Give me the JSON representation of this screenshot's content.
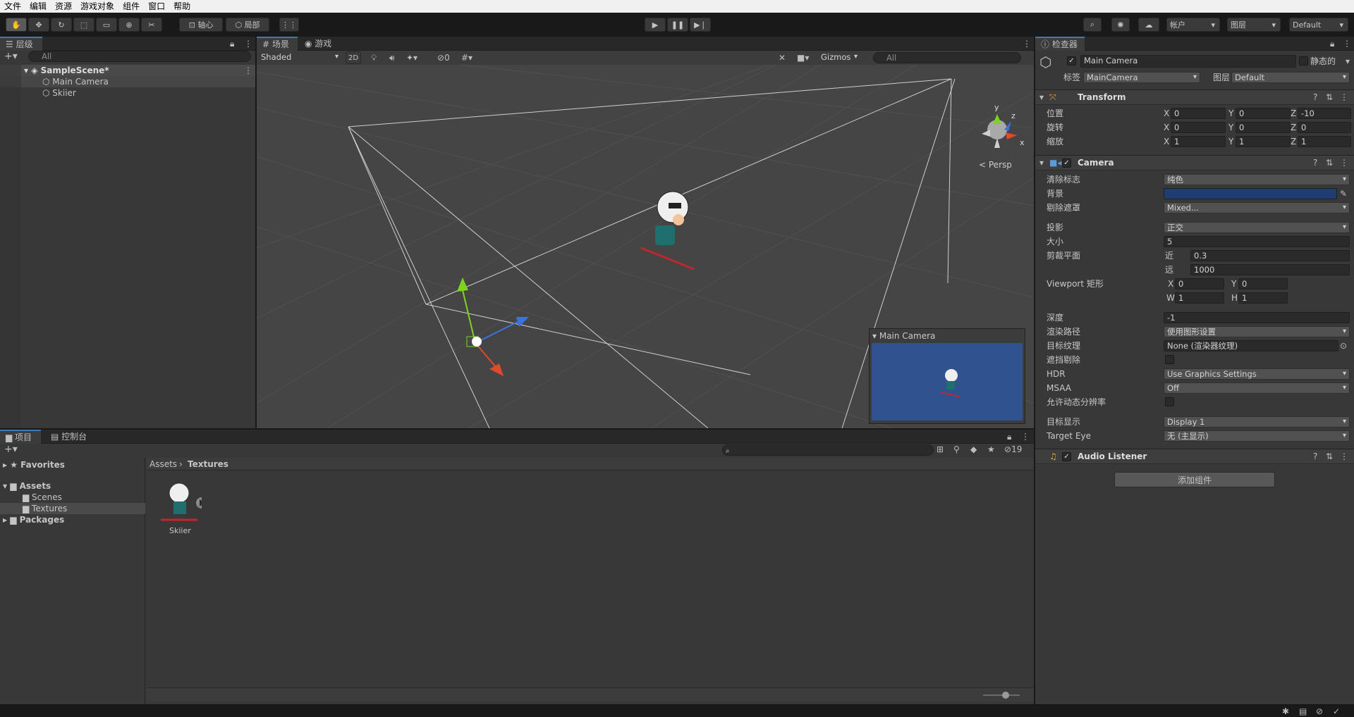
{
  "menu": [
    "文件",
    "编辑",
    "资源",
    "游戏对象",
    "组件",
    "窗口",
    "帮助"
  ],
  "toolbar": {
    "pivot": "轴心",
    "local": "局部",
    "account": "帐户",
    "layers": "图层",
    "layout": "Default"
  },
  "hierarchy": {
    "tab": "层级",
    "search_placeholder": "All",
    "scene": "SampleScene*",
    "items": [
      "Main Camera",
      "Skiier"
    ]
  },
  "scene_view": {
    "tab_scene": "场景",
    "tab_game": "游戏",
    "shading": "Shaded",
    "mode_2d": "2D",
    "hidden_count": "0",
    "gizmos": "Gizmos",
    "search_placeholder": "All",
    "persp": "Persp",
    "gizmo_y": "y",
    "gizmo_z": "z",
    "gizmo_x": "x",
    "cam_preview_title": "Main Camera"
  },
  "project": {
    "tab_project": "项目",
    "tab_console": "控制台",
    "favorites": "Favorites",
    "assets": "Assets",
    "scenes": "Scenes",
    "textures": "Textures",
    "packages": "Packages",
    "breadcrumb": [
      "Assets",
      "Textures"
    ],
    "asset_name": "Skiier",
    "count": "19"
  },
  "inspector": {
    "tab": "检查器",
    "object_name": "Main Camera",
    "static": "静态的",
    "tag_label": "标签",
    "tag_value": "MainCamera",
    "layer_label": "图层",
    "layer_value": "Default",
    "transform": {
      "title": "Transform",
      "position": "位置",
      "rotation": "旋转",
      "scale": "缩放",
      "pos": [
        "0",
        "0",
        "-10"
      ],
      "rot": [
        "0",
        "0",
        "0"
      ],
      "scl": [
        "1",
        "1",
        "1"
      ]
    },
    "camera": {
      "title": "Camera",
      "clear_flags": {
        "label": "清除标志",
        "value": "纯色"
      },
      "background": {
        "label": "背景",
        "color": "#1f3c75"
      },
      "culling": {
        "label": "剔除遮罩",
        "value": "Mixed..."
      },
      "projection": {
        "label": "投影",
        "value": "正交"
      },
      "size": {
        "label": "大小",
        "value": "5"
      },
      "clip": {
        "label": "剪裁平面",
        "near_label": "近",
        "near": "0.3",
        "far_label": "远",
        "far": "1000"
      },
      "viewport": {
        "label": "Viewport 矩形",
        "x": "0",
        "y": "0",
        "w": "1",
        "h": "1"
      },
      "depth": {
        "label": "深度",
        "value": "-1"
      },
      "render_path": {
        "label": "渲染路径",
        "value": "使用图形设置"
      },
      "target_texture": {
        "label": "目标纹理",
        "value": "None (渲染器纹理)"
      },
      "occlusion": {
        "label": "遮挡剔除"
      },
      "hdr": {
        "label": "HDR",
        "value": "Use Graphics Settings"
      },
      "msaa": {
        "label": "MSAA",
        "value": "Off"
      },
      "dynamic_res": {
        "label": "允许动态分辨率"
      },
      "target_display": {
        "label": "目标显示",
        "value": "Display 1"
      },
      "target_eye": {
        "label": "Target Eye",
        "value": "无 (主显示)"
      }
    },
    "audio": {
      "title": "Audio Listener"
    },
    "add_component": "添加组件"
  }
}
